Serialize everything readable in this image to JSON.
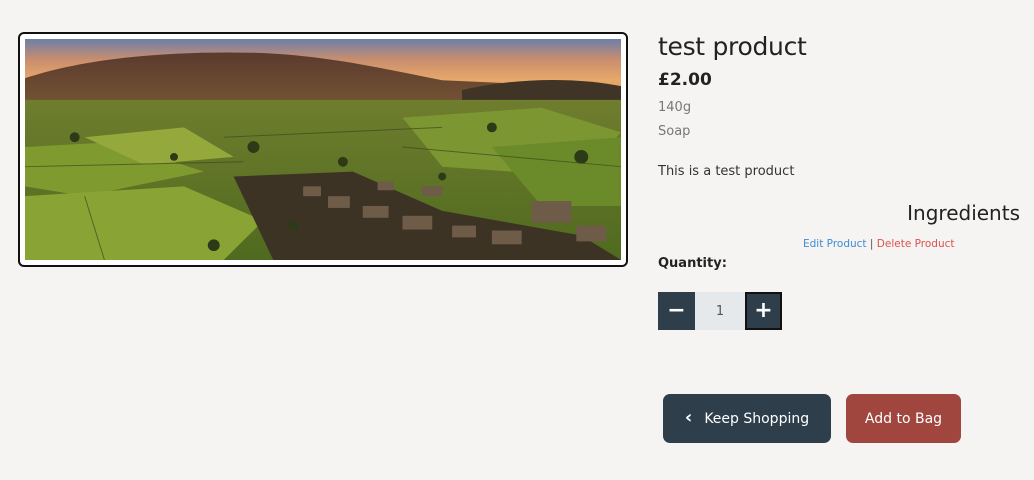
{
  "product": {
    "image_alt": "Landscape photo of a village in green valley at sunset",
    "name": "test product",
    "price": "£2.00",
    "size": "140g",
    "category": "Soap",
    "description": "This is a test product",
    "ingredients_heading": "Ingredients"
  },
  "admin": {
    "edit_label": "Edit Product",
    "separator": "|",
    "delete_label": "Delete Product"
  },
  "quantity": {
    "label": "Quantity:",
    "value": "1",
    "minus_icon": "minus-icon",
    "plus_icon": "plus-icon"
  },
  "actions": {
    "keep_shopping_label": "Keep Shopping",
    "add_to_bag_label": "Add to Bag",
    "keep_shopping_icon": "chevron-left-icon"
  },
  "colors": {
    "dark": "#2e3f4b",
    "bag": "#a0463f",
    "edit_link": "#3c8dd6",
    "delete_link": "#d9534f",
    "background": "#f5f4f2"
  }
}
